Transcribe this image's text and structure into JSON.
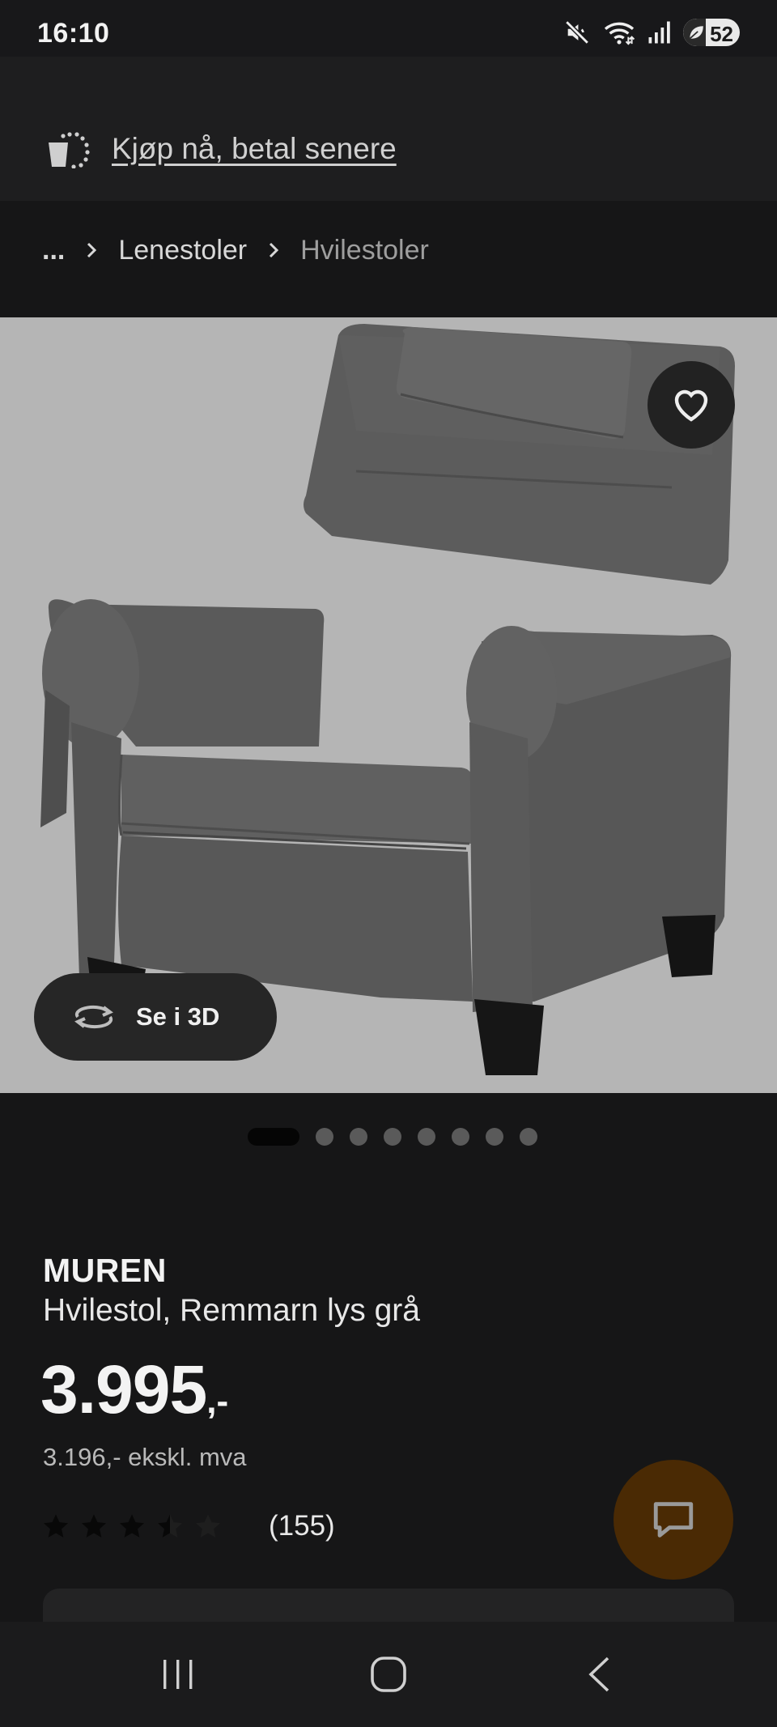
{
  "status_bar": {
    "time": "16:10",
    "battery": "52",
    "icons": [
      "mute-icon",
      "wifi-icon",
      "signal-icon",
      "battery-icon"
    ]
  },
  "promo": {
    "text": "Kjøp nå, betal senere",
    "icon": "installment-bag-icon"
  },
  "breadcrumb": {
    "ellipsis": "...",
    "items": [
      "Lenestoler",
      "Hvilestoler"
    ]
  },
  "gallery": {
    "button_3d_label": "Se i 3D",
    "dot_count": 8,
    "active_dot": 0
  },
  "product": {
    "brand": "MUREN",
    "description": "Hvilestol, Remmarn lys grå",
    "price": "3.995",
    "price_suffix": ",-",
    "price_ex_vat": "3.196,- ekskl. mva",
    "rating": 3.5,
    "rating_count": "(155)"
  },
  "colors": {
    "background": "#161617",
    "hero_bg": "#b5b5b5",
    "chat_button": "#4a2a04"
  }
}
